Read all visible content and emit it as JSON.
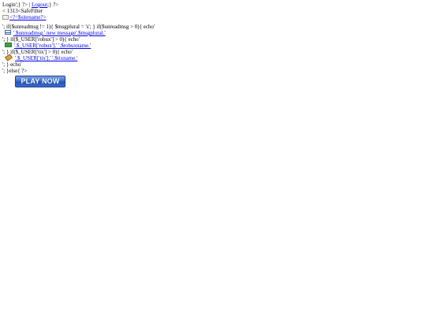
{
  "header": {
    "login_prefix": "Login';} ?> | ",
    "logout_link": "Logout",
    "logout_suffix": ";} ?>"
  },
  "filter_line": "< 1313<SafeFilter",
  "site_logo_alt": "<?=$sitename?>",
  "php_lines": {
    "msg_condition": "'; if($unreadmsg != 1){ $msgplural = 's'; } if($unreadmsg > 0){ echo'",
    "msg_link": "'.$unreadmsg.' new message'.$msgplural.'",
    "robux_condition": "'; } if($_USER['robux'] > 0){ echo'",
    "robux_link": "'.$_USER['robux'].' '.$robuxname.'",
    "tix_condition": "'; } if($_USER['tix'] > 0){ echo'",
    "tix_link": "'.$_USER['tix'].' '.$tixname.'",
    "echo_line": "'; } echo'",
    "else_line": "'; }else{ ?>"
  },
  "icons": {
    "messages": "mail-icon",
    "robux": "money-icon",
    "tix": "ticket-icon"
  },
  "play_button": {
    "label": "PLAY NOW",
    "color": "#3d6fd1"
  }
}
